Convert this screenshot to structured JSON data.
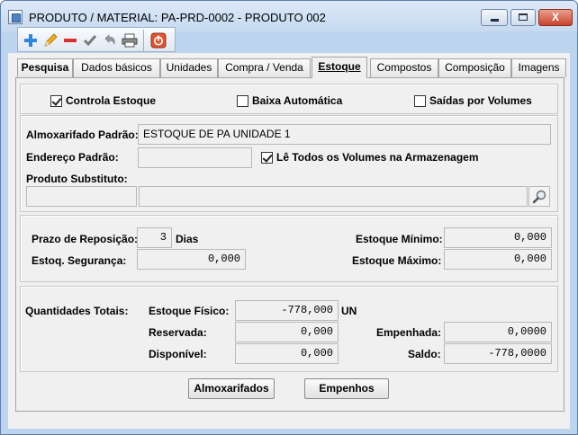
{
  "window": {
    "title": "PRODUTO / MATERIAL: PA-PRD-0002 - PRODUTO 002",
    "buttons": {
      "minimize": "minimize",
      "maximize": "maximize",
      "close": "X"
    }
  },
  "toolbar": {
    "icons": [
      "add-icon",
      "edit-pencil-icon",
      "delete-minus-icon",
      "confirm-check-icon",
      "undo-icon",
      "print-icon",
      "exit-power-icon"
    ]
  },
  "tabs": [
    {
      "label": "Pesquisa"
    },
    {
      "label": "Dados básicos"
    },
    {
      "label": "Unidades"
    },
    {
      "label": "Compra / Venda"
    },
    {
      "label": "Estoque"
    },
    {
      "label": "Compostos"
    },
    {
      "label": "Composição"
    },
    {
      "label": "Imagens"
    }
  ],
  "checks": {
    "controla_estoque": {
      "label": "Controla Estoque",
      "checked": true
    },
    "baixa_automatica": {
      "label": "Baixa Automática",
      "checked": false
    },
    "saidas_volumes": {
      "label": "Saídas por Volumes",
      "checked": false
    },
    "le_todos_volumes": {
      "label": "Lê Todos os Volumes na Armazenagem",
      "checked": true
    }
  },
  "almox": {
    "label": "Almoxarifado Padrão:",
    "value": "ESTOQUE DE PA UNIDADE 1",
    "endereco_label": "Endereço Padrão:",
    "endereco_value": "",
    "substituto_label": "Produto Substituto:",
    "substituto_code": "",
    "substituto_desc": ""
  },
  "reposicao": {
    "prazo_label": "Prazo de Reposição:",
    "prazo_value": "3",
    "prazo_unit": "Dias",
    "seguranca_label": "Estoq. Segurança:",
    "seguranca_value": "0,000",
    "minimo_label": "Estoque Mínimo:",
    "minimo_value": "0,000",
    "maximo_label": "Estoque Máximo:",
    "maximo_value": "0,000"
  },
  "quantidades": {
    "title": "Quantidades Totais:",
    "fisico_label": "Estoque Físico:",
    "fisico_value": "-778,000",
    "unit": "UN",
    "reservada_label": "Reservada:",
    "reservada_value": "0,000",
    "disponivel_label": "Disponível:",
    "disponivel_value": "0,000",
    "empenhada_label": "Empenhada:",
    "empenhada_value": "0,0000",
    "saldo_label": "Saldo:",
    "saldo_value": "-778,0000"
  },
  "actions": {
    "almoxarifados": "Almoxarifados",
    "empenhos": "Empenhos"
  }
}
